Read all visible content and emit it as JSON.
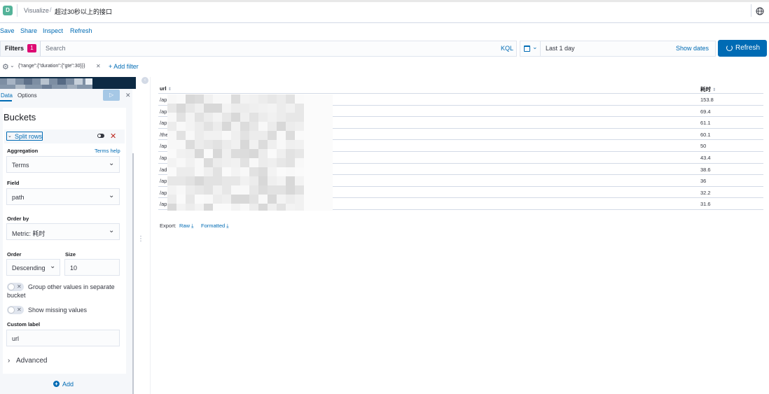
{
  "header": {
    "logo_letter": "D",
    "breadcrumb_app": "Visualize",
    "breadcrumb_sep": "/",
    "breadcrumb_title": "超过30秒以上的接口"
  },
  "menu": {
    "save": "Save",
    "share": "Share",
    "inspect": "Inspect",
    "refresh": "Refresh"
  },
  "query_bar": {
    "filters_label": "Filters",
    "filters_count": "1",
    "search_placeholder": "Search",
    "language": "KQL",
    "date_range": "Last 1 day",
    "show_dates": "Show dates",
    "refresh_button": "Refresh"
  },
  "filter_bar": {
    "filter_pill": "{\"range\":{\"duration\":{\"gte\":30}}}",
    "add_filter": "+ Add filter"
  },
  "sidebar": {
    "tabs": [
      "Data",
      "Options"
    ],
    "buckets_title": "Buckets",
    "split_rows_label": "Split rows",
    "aggregation_label": "Aggregation",
    "aggregation_help": "Terms help",
    "aggregation_value": "Terms",
    "field_label": "Field",
    "field_value": "path",
    "order_by_label": "Order by",
    "order_by_value": "Metric: 耗时",
    "order_label": "Order",
    "order_value": "Descending",
    "size_label": "Size",
    "size_value": "10",
    "group_other_label": "Group other values in separate bucket",
    "show_missing_label": "Show missing values",
    "custom_label_label": "Custom label",
    "custom_label_value": "url",
    "advanced_label": "Advanced",
    "add_label": "Add"
  },
  "table": {
    "columns": [
      "url",
      "耗时"
    ],
    "rows": [
      {
        "url": "/ap",
        "value": "153.8"
      },
      {
        "url": "/ap",
        "value": "69.4"
      },
      {
        "url": "/ap",
        "value": "61.1"
      },
      {
        "url": "/the",
        "value": "60.1"
      },
      {
        "url": "/ap",
        "value": "50"
      },
      {
        "url": "/ap",
        "value": "43.4"
      },
      {
        "url": "/ad",
        "value": "38.6"
      },
      {
        "url": "/ap",
        "value": "36"
      },
      {
        "url": "/ap",
        "value": "32.2"
      },
      {
        "url": "/ap",
        "value": "31.6"
      }
    ],
    "export_label": "Export:",
    "export_raw": "Raw",
    "export_formatted": "Formatted"
  },
  "colors": {
    "primary": "#006bb4",
    "badge": "#dd0a73",
    "danger": "#bd271e",
    "logo": "#54b399"
  }
}
